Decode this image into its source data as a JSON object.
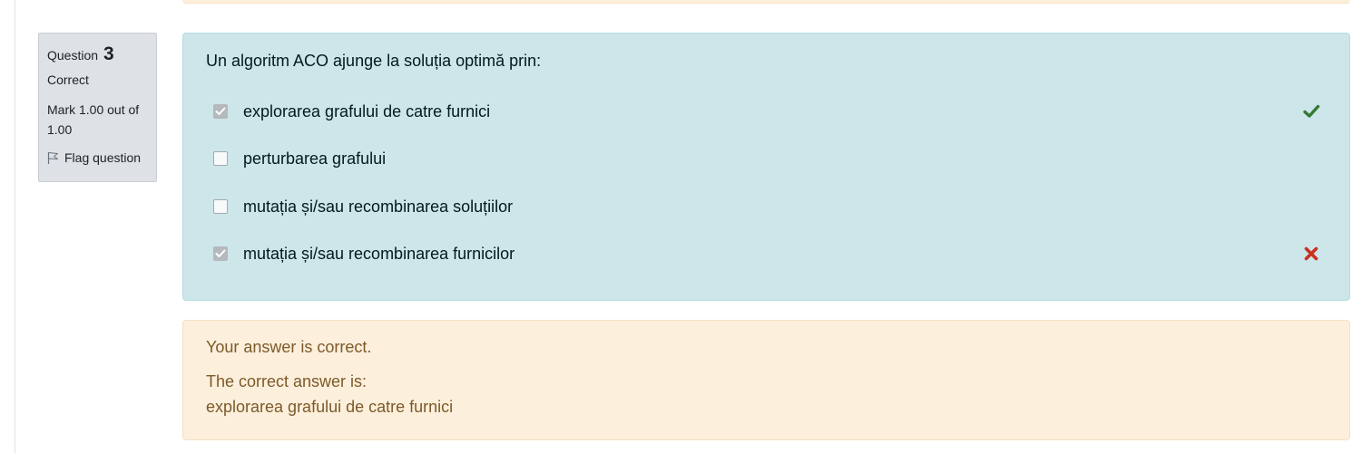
{
  "question": {
    "label": "Question",
    "number": "3",
    "state": "Correct",
    "grade": "Mark 1.00 out of 1.00",
    "flag_label": "Flag question",
    "text": "Un algoritm ACO ajunge la soluția optimă prin:"
  },
  "answers": [
    {
      "label": "explorarea grafului de catre furnici",
      "checked": true,
      "mark": "correct-icon"
    },
    {
      "label": "perturbarea grafului",
      "checked": false,
      "mark": ""
    },
    {
      "label": "mutația și/sau recombinarea soluțiilor",
      "checked": false,
      "mark": ""
    },
    {
      "label": "mutația și/sau recombinarea furnicilor",
      "checked": true,
      "mark": "incorrect-icon"
    }
  ],
  "feedback": {
    "specific": "Your answer is correct.",
    "right_answer_title": "The correct answer is:",
    "right_answer_value": "explorarea grafului de catre furnici"
  },
  "colors": {
    "formulation_bg": "#cce6ea",
    "feedback_bg": "#fcefdc",
    "info_bg": "#dee2e6",
    "correct": "#357a32",
    "incorrect": "#ca3120"
  }
}
